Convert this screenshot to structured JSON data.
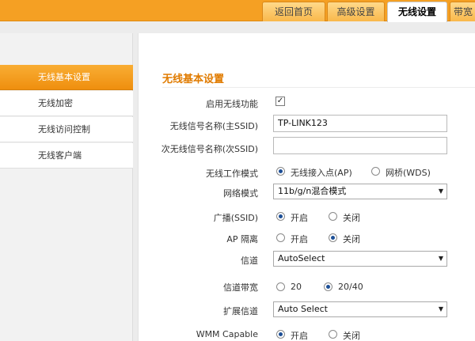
{
  "top_tabs": [
    "返回首页",
    "高级设置",
    "无线设置",
    "带宽"
  ],
  "sidebar": {
    "items": [
      {
        "label": "无线基本设置",
        "active": true
      },
      {
        "label": "无线加密",
        "active": false
      },
      {
        "label": "无线访问控制",
        "active": false
      },
      {
        "label": "无线客户端",
        "active": false
      }
    ]
  },
  "main": {
    "title": "无线基本设置",
    "enable_label": "启用无线功能",
    "enable_checked": true,
    "ssid_label": "无线信号名称(主SSID)",
    "ssid_value": "TP-LINK123",
    "ssid2_label": "次无线信号名称(次SSID)",
    "ssid2_value": "",
    "mode_label": "无线工作模式",
    "mode_options": [
      "无线接入点(AP)",
      "网桥(WDS)"
    ],
    "net_mode_label": "网络模式",
    "net_mode_value": "11b/g/n混合模式",
    "broadcast_label": "广播(SSID)",
    "on_off": [
      "开启",
      "关闭"
    ],
    "ap_iso_label": "AP 隔离",
    "channel_label": "信道",
    "channel_value": "AutoSelect",
    "bandwidth_label": "信道带宽",
    "bandwidth_options": [
      "20",
      "20/40"
    ],
    "ext_channel_label": "扩展信道",
    "ext_channel_value": "Auto Select",
    "wmm_label": "WMM Capable"
  },
  "colors": {
    "accent": "#f5a023",
    "title": "#e07b00"
  }
}
